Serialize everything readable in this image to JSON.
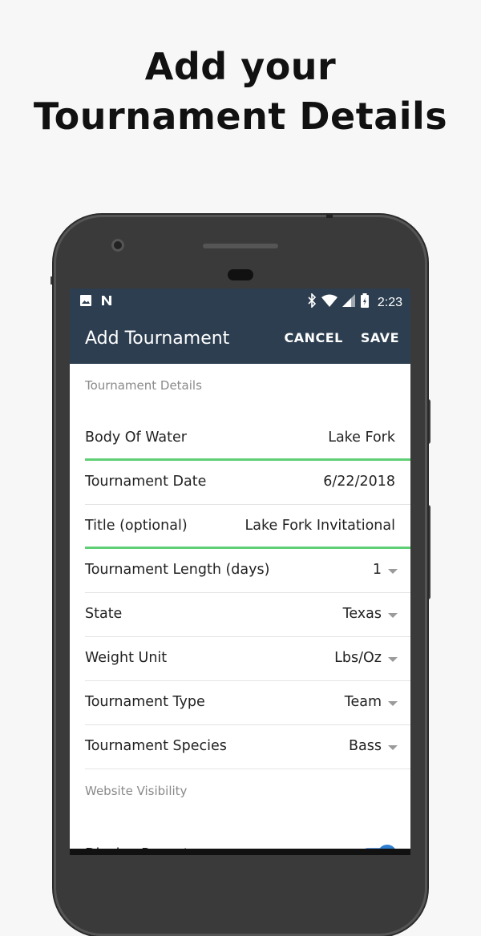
{
  "headline": {
    "line1": "Add your",
    "line2": "Tournament Details"
  },
  "statusbar": {
    "left_icons": [
      "image-icon",
      "n-icon"
    ],
    "right_icons": [
      "bluetooth-icon",
      "wifi-icon",
      "signal-icon",
      "battery-icon"
    ],
    "time": "2:23"
  },
  "appbar": {
    "title": "Add Tournament",
    "cancel": "CANCEL",
    "save": "SAVE",
    "color": "#2c3e50"
  },
  "form": {
    "section_details": "Tournament Details",
    "rows": [
      {
        "label": "Body Of Water",
        "value": "Lake Fork"
      },
      {
        "label": "Tournament Date",
        "value": "6/22/2018"
      },
      {
        "label": "Title (optional)",
        "value": "Lake Fork Invitational"
      },
      {
        "label": "Tournament Length (days)",
        "value": "1"
      },
      {
        "label": "State",
        "value": "Texas"
      },
      {
        "label": "Weight Unit",
        "value": "Lbs/Oz"
      },
      {
        "label": "Tournament Type",
        "value": "Team"
      },
      {
        "label": "Tournament Species",
        "value": "Bass"
      }
    ],
    "section_visibility": "Website Visibility",
    "display_payouts": "Display Payouts",
    "display_payouts_on": true
  },
  "colors": {
    "accent_green": "#5ecf75",
    "toggle_blue": "#2f7fd1"
  }
}
